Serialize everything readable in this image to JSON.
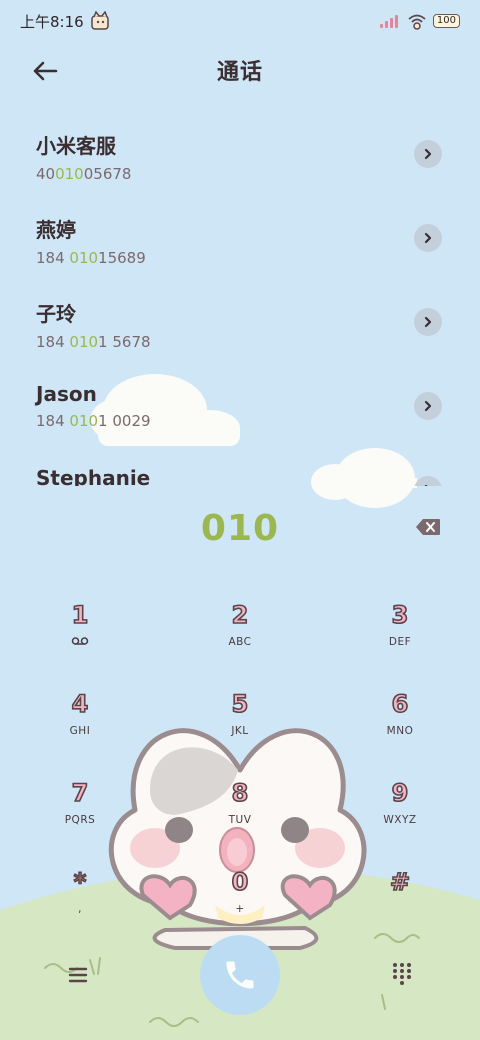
{
  "status_bar": {
    "time": "上午8:16",
    "battery": "100"
  },
  "header": {
    "title": "通话"
  },
  "contacts": [
    {
      "name": "小米客服",
      "number_prefix": "40",
      "number_match": "010",
      "number_suffix": "05678"
    },
    {
      "name": "燕婷",
      "number_prefix": "184 ",
      "number_match": "010",
      "number_suffix": "15689"
    },
    {
      "name": "子玲",
      "number_prefix": "184 ",
      "number_match": "010",
      "number_suffix": "1 5678"
    },
    {
      "name": "Jason",
      "number_prefix": "184 ",
      "number_match": "010",
      "number_suffix": "1 0029"
    },
    {
      "name": "Stephanie",
      "number_prefix": "",
      "number_match": "",
      "number_suffix": ""
    }
  ],
  "dialer": {
    "input": "010"
  },
  "keypad": [
    {
      "digit": "1",
      "letters": ""
    },
    {
      "digit": "2",
      "letters": "ABC"
    },
    {
      "digit": "3",
      "letters": "DEF"
    },
    {
      "digit": "4",
      "letters": "GHI"
    },
    {
      "digit": "5",
      "letters": "JKL"
    },
    {
      "digit": "6",
      "letters": "MNO"
    },
    {
      "digit": "7",
      "letters": "PQRS"
    },
    {
      "digit": "8",
      "letters": "TUV"
    },
    {
      "digit": "9",
      "letters": "WXYZ"
    },
    {
      "digit": "*",
      "letters": ","
    },
    {
      "digit": "0",
      "letters": "+"
    },
    {
      "digit": "#",
      "letters": ""
    }
  ],
  "colors": {
    "sky": "#cfe6f7",
    "grass": "#d6e7c4",
    "highlight": "#9ab84e",
    "key_fill": "#f4b3c4",
    "call_button": "#bcdcf3"
  }
}
